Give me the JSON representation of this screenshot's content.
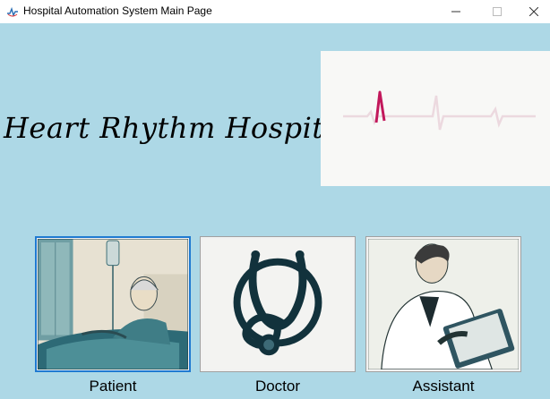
{
  "window": {
    "title": "Hospital Automation System Main Page",
    "controls": [
      "minimize-icon",
      "maximize-icon",
      "close-icon"
    ]
  },
  "header": {
    "hospital_name": "Heart Rhythm Hospital"
  },
  "ecg_image": {
    "icon": "ecg-heartbeat-graphic",
    "accent": "#c2185b"
  },
  "roles": [
    {
      "label": "Patient",
      "icon": "patient-in-bed-illustration",
      "selected": true
    },
    {
      "label": "Doctor",
      "icon": "stethoscope-illustration",
      "selected": false
    },
    {
      "label": "Assistant",
      "icon": "assistant-with-clipboard-illustration",
      "selected": false
    }
  ],
  "colors": {
    "background": "#add8e6",
    "selection_border": "#1f7ad1"
  }
}
